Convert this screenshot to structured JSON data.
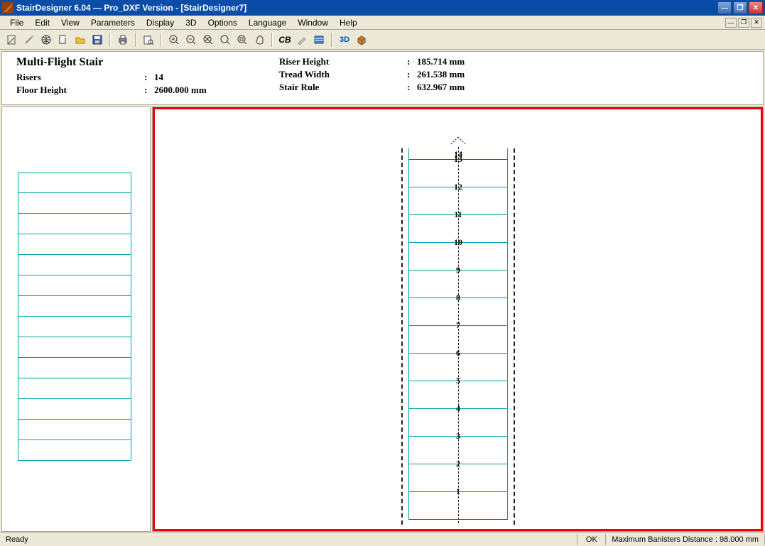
{
  "window": {
    "title": "StairDesigner 6.04 — Pro_DXF Version - [StairDesigner7]"
  },
  "menu": {
    "file": "File",
    "edit": "Edit",
    "view": "View",
    "parameters": "Parameters",
    "display": "Display",
    "three_d": "3D",
    "options": "Options",
    "language": "Language",
    "window": "Window",
    "help": "Help"
  },
  "toolbar": {
    "cb": "CB",
    "three_d": "3D"
  },
  "info": {
    "title": "Multi-Flight Stair",
    "risers_label": "Risers",
    "risers_value": "14",
    "floor_height_label": "Floor Height",
    "floor_height_value": "2600.000 mm",
    "riser_height_label": "Riser Height",
    "riser_height_value": "185.714 mm",
    "tread_width_label": "Tread Width",
    "tread_width_value": "261.538 mm",
    "stair_rule_label": "Stair Rule",
    "stair_rule_value": "632.967 mm"
  },
  "treads": {
    "t14": "14",
    "t13": "13",
    "t12": "12",
    "t11": "11",
    "t10": "10",
    "t9": "9",
    "t8": "8",
    "t7": "7",
    "t6": "6",
    "t5": "5",
    "t4": "4",
    "t3": "3",
    "t2": "2",
    "t1": "1"
  },
  "status": {
    "ready": "Ready",
    "ok": "OK",
    "banisters": "Maximum Banisters Distance : 98.000 mm"
  }
}
